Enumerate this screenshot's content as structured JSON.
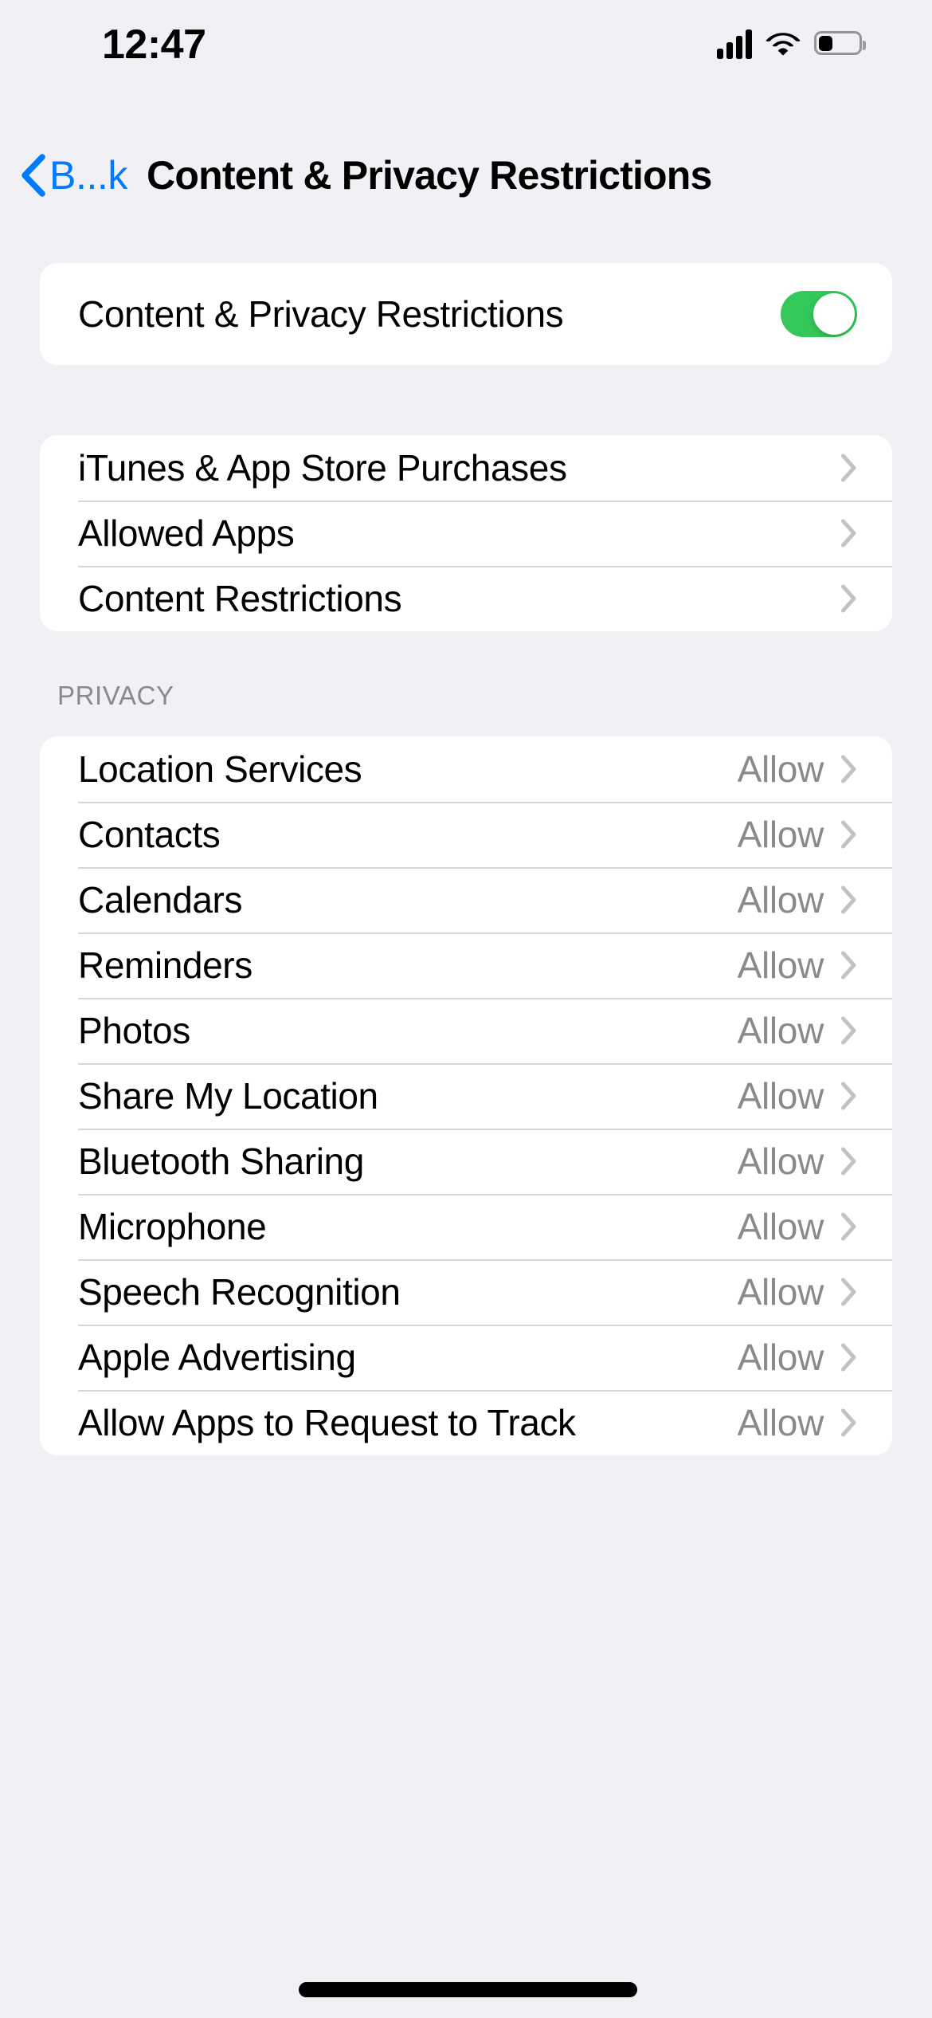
{
  "status_bar": {
    "time": "12:47",
    "cellular_icon": "cellular-signal-icon",
    "wifi_icon": "wifi-icon",
    "battery_icon": "battery-icon",
    "battery_level_percent": 35
  },
  "nav": {
    "back_label": "B...k",
    "back_chevron_icon": "chevron-left-icon",
    "title": "Content & Privacy Restrictions",
    "accent_color": "#007AFF"
  },
  "master_toggle": {
    "label": "Content & Privacy Restrictions",
    "state": "on",
    "on_color": "#34C759"
  },
  "links_section": {
    "items": [
      {
        "label": "iTunes & App Store Purchases"
      },
      {
        "label": "Allowed Apps"
      },
      {
        "label": "Content Restrictions"
      }
    ]
  },
  "privacy_section": {
    "header": "PRIVACY",
    "items": [
      {
        "label": "Location Services",
        "value": "Allow"
      },
      {
        "label": "Contacts",
        "value": "Allow"
      },
      {
        "label": "Calendars",
        "value": "Allow"
      },
      {
        "label": "Reminders",
        "value": "Allow"
      },
      {
        "label": "Photos",
        "value": "Allow"
      },
      {
        "label": "Share My Location",
        "value": "Allow"
      },
      {
        "label": "Bluetooth Sharing",
        "value": "Allow"
      },
      {
        "label": "Microphone",
        "value": "Allow"
      },
      {
        "label": "Speech Recognition",
        "value": "Allow"
      },
      {
        "label": "Apple Advertising",
        "value": "Allow"
      },
      {
        "label": "Allow Apps to Request to Track",
        "value": "Allow"
      }
    ]
  },
  "colors": {
    "background": "#F0F0F5",
    "card": "#FFFFFF",
    "separator": "#D5D5DA",
    "secondary_text": "#8A8A8E",
    "primary_text": "#000000"
  }
}
